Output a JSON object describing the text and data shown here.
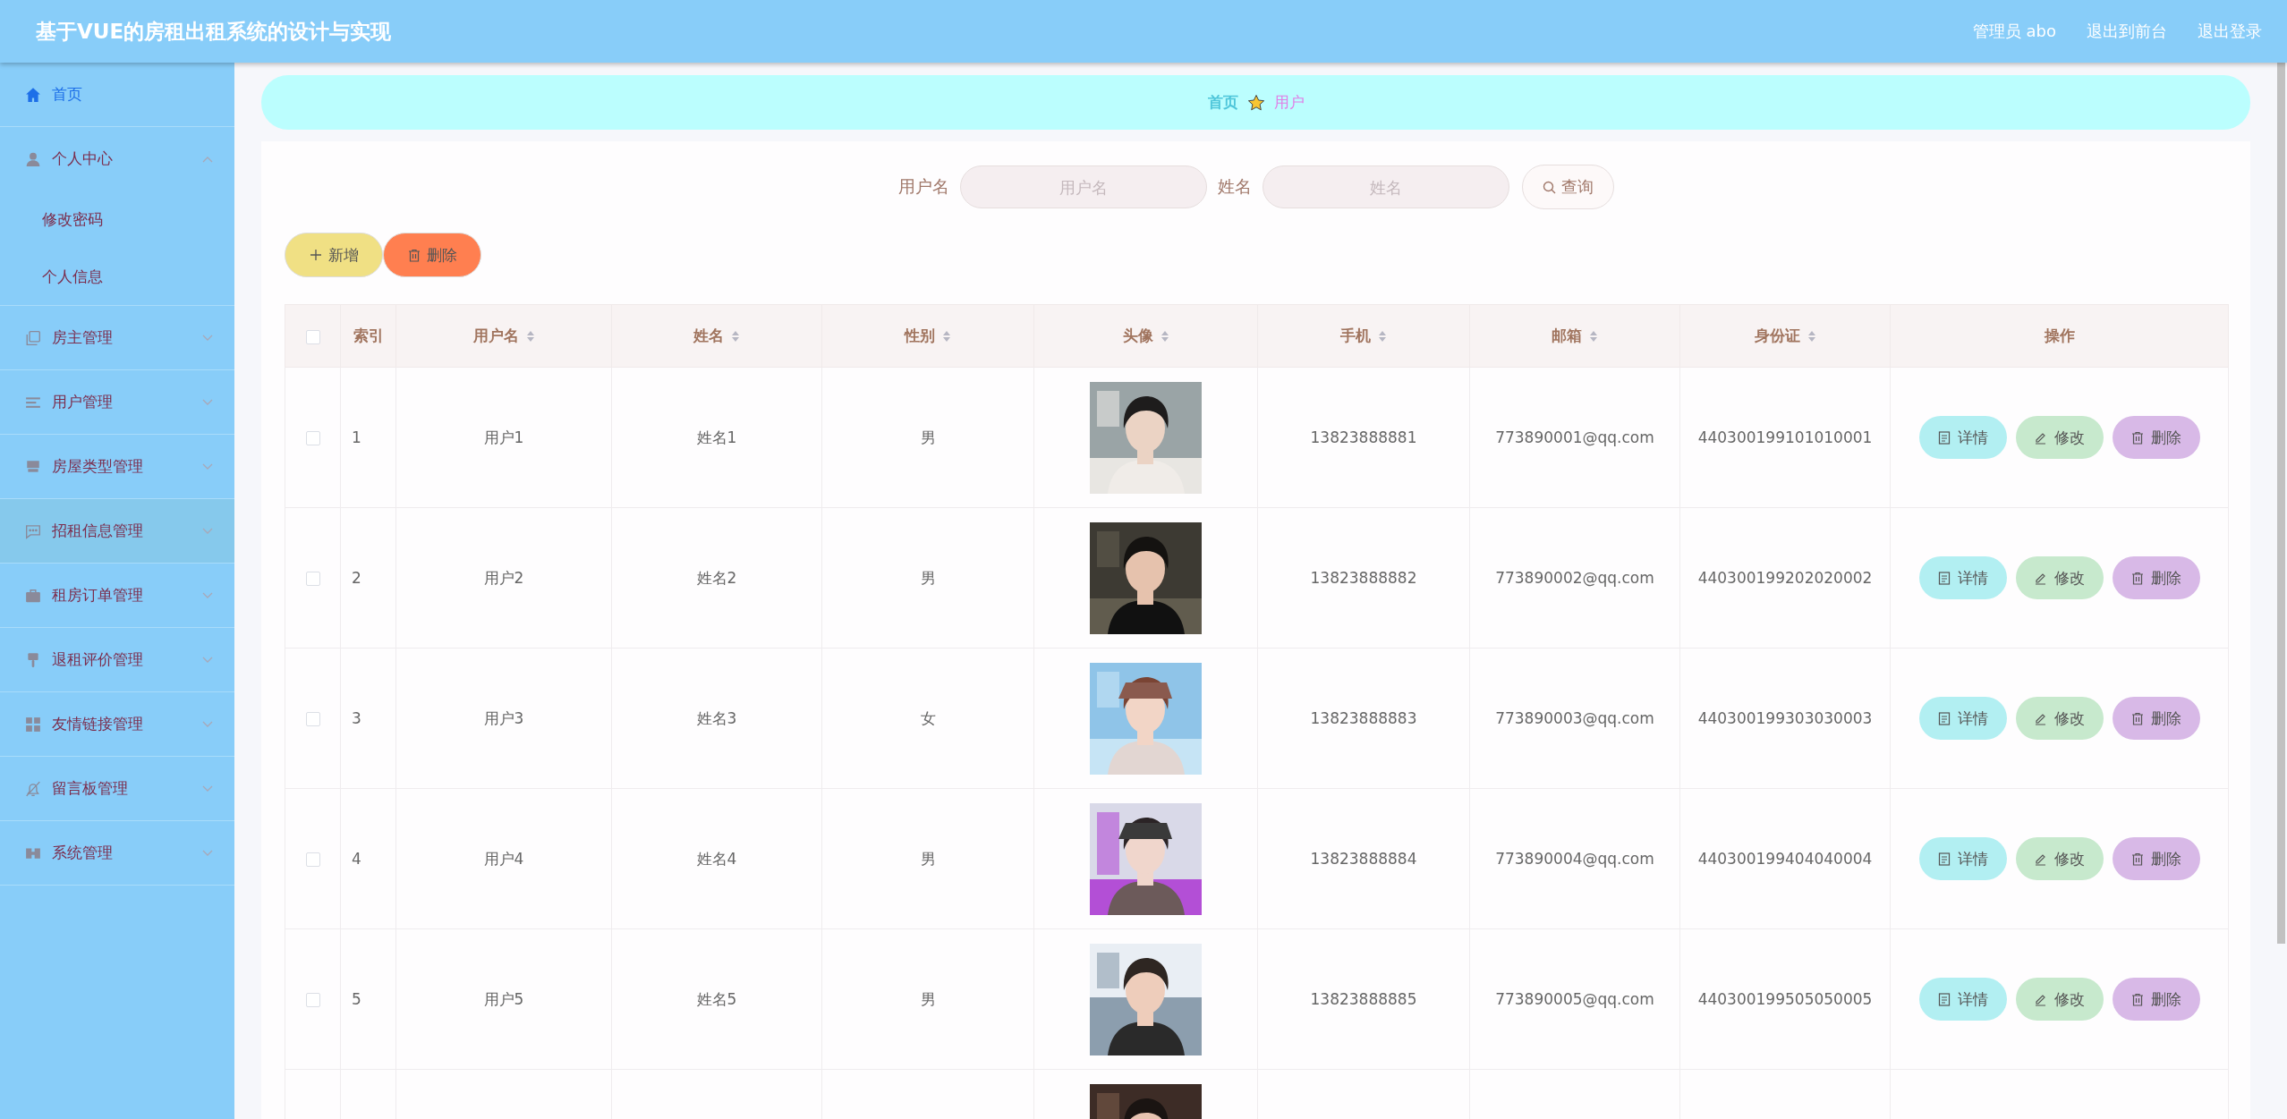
{
  "header": {
    "title": "基于VUE的房租出租系统的设计与实现",
    "links": [
      "管理员 abo",
      "退出到前台",
      "退出登录"
    ]
  },
  "sidebar": {
    "items": [
      {
        "label": "首页",
        "selected": true,
        "highlighted": false
      },
      {
        "label": "个人中心",
        "selected": false,
        "highlighted": false,
        "expanded": true,
        "children": [
          {
            "label": "修改密码"
          },
          {
            "label": "个人信息"
          }
        ]
      },
      {
        "label": "房主管理",
        "selected": false,
        "highlighted": false,
        "expanded": false
      },
      {
        "label": "用户管理",
        "selected": false,
        "highlighted": false,
        "expanded": false
      },
      {
        "label": "房屋类型管理",
        "selected": false,
        "highlighted": false,
        "expanded": false
      },
      {
        "label": "招租信息管理",
        "selected": false,
        "highlighted": true,
        "expanded": false
      },
      {
        "label": "租房订单管理",
        "selected": false,
        "highlighted": false,
        "expanded": false
      },
      {
        "label": "退租评价管理",
        "selected": false,
        "highlighted": false,
        "expanded": false
      },
      {
        "label": "友情链接管理",
        "selected": false,
        "highlighted": false,
        "expanded": false
      },
      {
        "label": "留言板管理",
        "selected": false,
        "highlighted": false,
        "expanded": false
      },
      {
        "label": "系统管理",
        "selected": false,
        "highlighted": false,
        "expanded": false
      }
    ]
  },
  "breadcrumb": [
    "首页",
    "用户"
  ],
  "search": {
    "fields": [
      {
        "label": "用户名",
        "placeholder": "用户名"
      },
      {
        "label": "姓名",
        "placeholder": "姓名"
      }
    ],
    "button": "查询"
  },
  "toolbar": [
    {
      "kind": "add",
      "label": "新增"
    },
    {
      "kind": "delete",
      "label": "删除"
    }
  ],
  "table": {
    "select_all": {
      "checked": false
    },
    "columns": [
      {
        "label": "索引",
        "sortable": false
      },
      {
        "label": "用户名",
        "sortable": true
      },
      {
        "label": "姓名",
        "sortable": true
      },
      {
        "label": "性别",
        "sortable": true
      },
      {
        "label": "头像",
        "sortable": true
      },
      {
        "label": "手机",
        "sortable": true
      },
      {
        "label": "邮箱",
        "sortable": true
      },
      {
        "label": "身份证",
        "sortable": true
      },
      {
        "label": "操作",
        "sortable": false
      }
    ],
    "rows": [
      {
        "checked": false,
        "index": "1",
        "username": "用户1",
        "name": "姓名1",
        "gender": "男",
        "avatar": {
          "kind": "picture"
        },
        "phone": "13823888881",
        "email": "773890001@qq.com",
        "id_card": "440300199101010001",
        "buttons": [
          {
            "kind": "detail",
            "label": "详情"
          },
          {
            "kind": "edit",
            "label": "修改"
          },
          {
            "kind": "delete",
            "label": "删除"
          }
        ]
      },
      {
        "checked": false,
        "index": "2",
        "username": "用户2",
        "name": "姓名2",
        "gender": "男",
        "avatar": {
          "kind": "picture"
        },
        "phone": "13823888882",
        "email": "773890002@qq.com",
        "id_card": "440300199202020002",
        "buttons": [
          {
            "kind": "detail",
            "label": "详情"
          },
          {
            "kind": "edit",
            "label": "修改"
          },
          {
            "kind": "delete",
            "label": "删除"
          }
        ]
      },
      {
        "checked": false,
        "index": "3",
        "username": "用户3",
        "name": "姓名3",
        "gender": "女",
        "avatar": {
          "kind": "picture"
        },
        "phone": "13823888883",
        "email": "773890003@qq.com",
        "id_card": "440300199303030003",
        "buttons": [
          {
            "kind": "detail",
            "label": "详情"
          },
          {
            "kind": "edit",
            "label": "修改"
          },
          {
            "kind": "delete",
            "label": "删除"
          }
        ]
      },
      {
        "checked": false,
        "index": "4",
        "username": "用户4",
        "name": "姓名4",
        "gender": "男",
        "avatar": {
          "kind": "picture"
        },
        "phone": "13823888884",
        "email": "773890004@qq.com",
        "id_card": "440300199404040004",
        "buttons": [
          {
            "kind": "detail",
            "label": "详情"
          },
          {
            "kind": "edit",
            "label": "修改"
          },
          {
            "kind": "delete",
            "label": "删除"
          }
        ]
      },
      {
        "checked": false,
        "index": "5",
        "username": "用户5",
        "name": "姓名5",
        "gender": "男",
        "avatar": {
          "kind": "picture"
        },
        "phone": "13823888885",
        "email": "773890005@qq.com",
        "id_card": "440300199505050005",
        "buttons": [
          {
            "kind": "detail",
            "label": "详情"
          },
          {
            "kind": "edit",
            "label": "修改"
          },
          {
            "kind": "delete",
            "label": "删除"
          }
        ]
      },
      {
        "avatar": {
          "kind": "picture"
        }
      }
    ]
  }
}
